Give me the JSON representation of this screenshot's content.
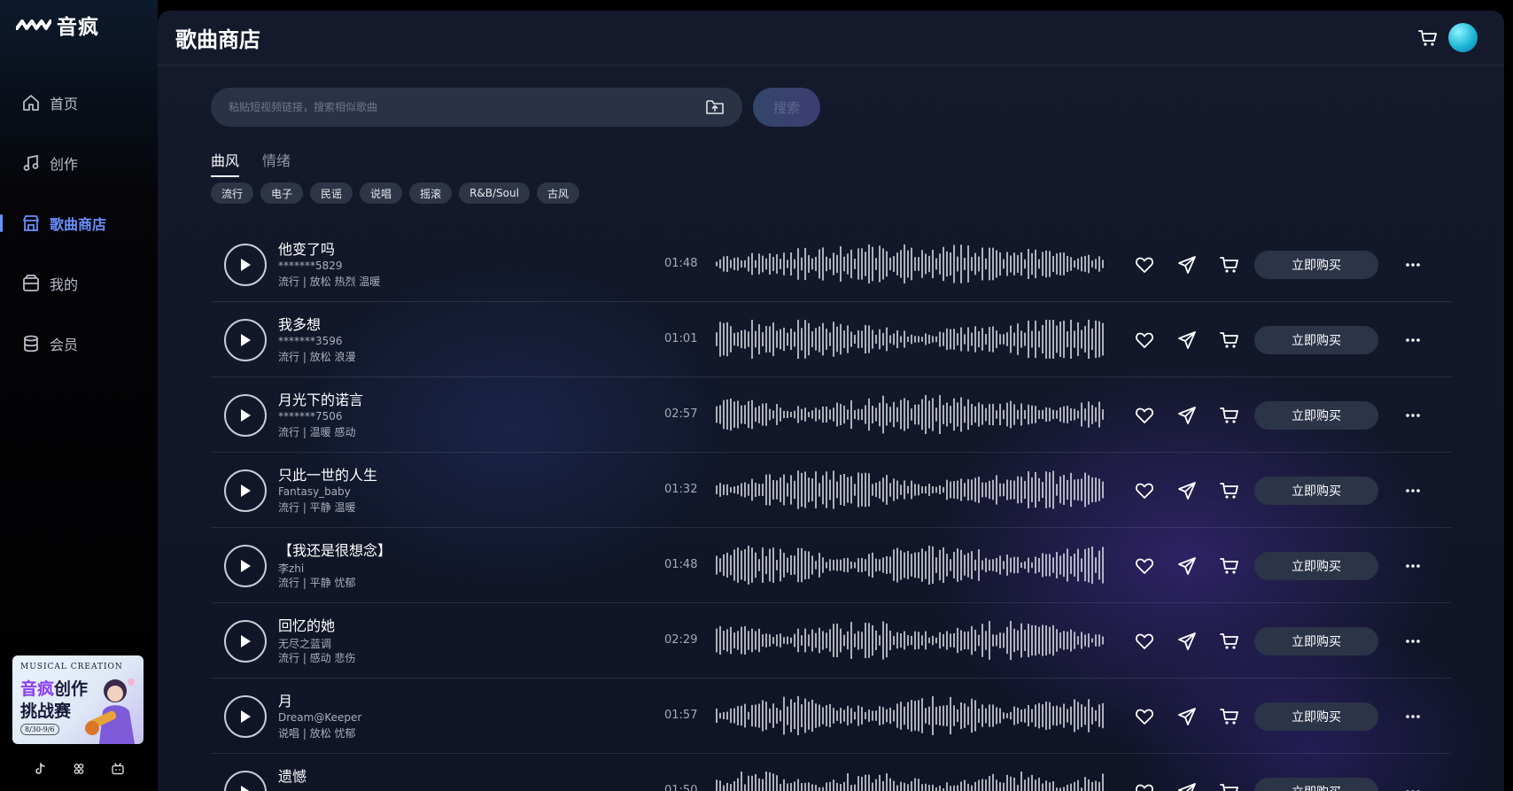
{
  "app": {
    "name": "音疯"
  },
  "sidebar": {
    "items": [
      {
        "label": "首页",
        "icon": "home-icon",
        "active": false
      },
      {
        "label": "创作",
        "icon": "music-note-icon",
        "active": false
      },
      {
        "label": "歌曲商店",
        "icon": "store-icon",
        "active": true
      },
      {
        "label": "我的",
        "icon": "folder-icon",
        "active": false
      },
      {
        "label": "会员",
        "icon": "database-icon",
        "active": false
      }
    ],
    "promo": {
      "line_top": "MUSICAL CREATION",
      "line1_highlight": "音疯",
      "line1_rest": "创作",
      "line2": "挑战赛",
      "date": "8/30-9/6"
    },
    "social": [
      "tiktok-icon",
      "community-icon",
      "bilibili-icon"
    ]
  },
  "header": {
    "title": "歌曲商店"
  },
  "search": {
    "placeholder": "粘贴短视频链接，搜索相似歌曲",
    "button": "搜索"
  },
  "tabs": [
    {
      "label": "曲风",
      "active": true
    },
    {
      "label": "情绪",
      "active": false
    }
  ],
  "chips": [
    "流行",
    "电子",
    "民谣",
    "说唱",
    "摇滚",
    "R&B/Soul",
    "古风"
  ],
  "colors": {
    "accent": "#6b8fff",
    "bg": "#141a2c",
    "button": "#2c3448"
  },
  "buy_label": "立即购买",
  "songs": [
    {
      "title": "他变了吗",
      "artist": "*******5829",
      "tags": "流行 | 放松 热烈 温暖",
      "duration": "01:48"
    },
    {
      "title": "我多想",
      "artist": "*******3596",
      "tags": "流行 | 放松 浪漫",
      "duration": "01:01"
    },
    {
      "title": "月光下的诺言",
      "artist": "*******7506",
      "tags": "流行 | 温暖 感动",
      "duration": "02:57"
    },
    {
      "title": "只此一世的人生",
      "artist": "Fantasy_baby",
      "tags": "流行 | 平静 温暖",
      "duration": "01:32"
    },
    {
      "title": "【我还是很想念】",
      "artist": "李zhi",
      "tags": "流行 | 平静 忧郁",
      "duration": "01:48"
    },
    {
      "title": "回忆的她",
      "artist": "无尽之蓝调",
      "tags": "流行 | 感动 悲伤",
      "duration": "02:29"
    },
    {
      "title": "月",
      "artist": "Dream@Keeper",
      "tags": "说唱 | 放松 忧郁",
      "duration": "01:57"
    },
    {
      "title": "遗憾",
      "artist": "",
      "tags": "",
      "duration": "01:50"
    }
  ]
}
